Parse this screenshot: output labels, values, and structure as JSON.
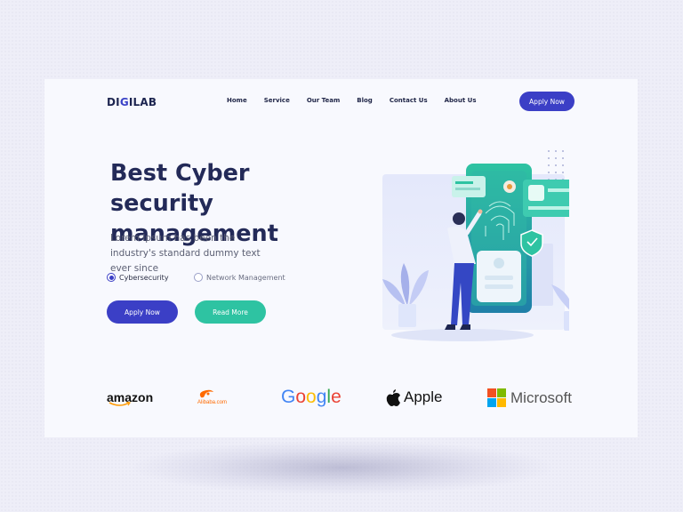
{
  "header": {
    "logo": {
      "pre": "DI",
      "arc": "G",
      "post": "ILAB"
    },
    "nav": [
      "Home",
      "Service",
      "Our Team",
      "Blog",
      "Contact Us",
      "About Us"
    ],
    "apply_label": "Apply Now"
  },
  "hero": {
    "title_line1": "Best Cyber security",
    "title_line2": "management",
    "subtitle": "Lorem Ipsum has been the industry's standard dummy text ever since",
    "options": [
      {
        "label": "Cybersecurity",
        "selected": true
      },
      {
        "label": "Network Management",
        "selected": false
      }
    ],
    "apply_label": "Apply Now",
    "read_more_label": "Read More"
  },
  "brands": {
    "amazon": "amazon",
    "alibaba": "Alibaba.com",
    "google": [
      "G",
      "o",
      "o",
      "g",
      "l",
      "e"
    ],
    "apple": "Apple",
    "microsoft": "Microsoft"
  },
  "colors": {
    "primary": "#3b3fc6",
    "accent": "#2ec3a2",
    "heading": "#232a58"
  }
}
